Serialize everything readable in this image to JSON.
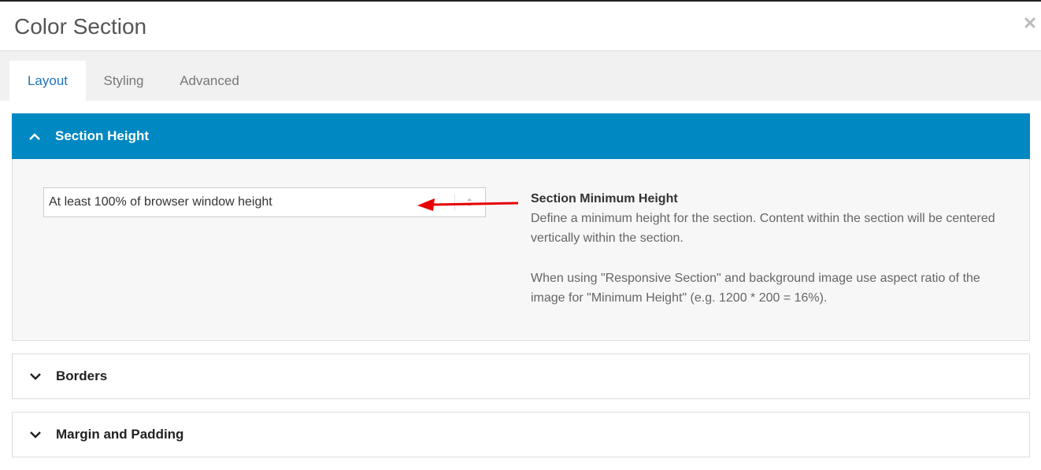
{
  "header": {
    "title": "Color Section",
    "close_icon": "close-icon"
  },
  "tabs": [
    {
      "label": "Layout",
      "active": true
    },
    {
      "label": "Styling",
      "active": false
    },
    {
      "label": "Advanced",
      "active": false
    }
  ],
  "panels": {
    "section_height": {
      "label": "Section Height",
      "expanded": true,
      "select_value": "At least 100% of browser window height",
      "help_title": "Section Minimum Height",
      "help_text_1": "Define a minimum height for the section. Content within the section will be centered vertically within the section.",
      "help_text_2": "When using \"Responsive Section\" and background image use aspect ratio of the image for \"Minimum Height\" (e.g. 1200 * 200 = 16%)."
    },
    "borders": {
      "label": "Borders",
      "expanded": false
    },
    "margin_padding": {
      "label": "Margin and Padding",
      "expanded": false
    }
  },
  "colors": {
    "accent": "#0088c2",
    "tab_active_text": "#1e73be",
    "annotation_arrow": "#e60000"
  }
}
